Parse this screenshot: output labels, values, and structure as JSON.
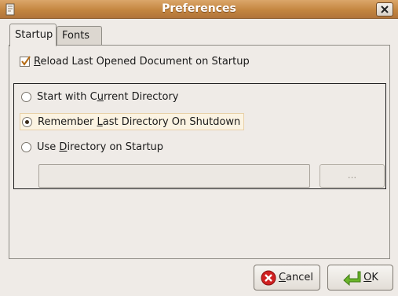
{
  "window": {
    "title": "Preferences"
  },
  "tabs": [
    {
      "label": "Startup",
      "active": true
    },
    {
      "label": "Fonts",
      "active": false
    }
  ],
  "startup": {
    "reload_checkbox": {
      "label_pre": "",
      "label_mnemonic": "R",
      "label_post": "eload Last Opened Document on Startup",
      "checked": true
    },
    "radios": [
      {
        "label_pre": "Start with C",
        "label_mnemonic": "u",
        "label_post": "rrent Directory",
        "selected": false
      },
      {
        "label_pre": "Remember ",
        "label_mnemonic": "L",
        "label_post": "ast Directory On Shutdown",
        "selected": true
      },
      {
        "label_pre": "Use ",
        "label_mnemonic": "D",
        "label_post": "irectory on Startup",
        "selected": false
      }
    ],
    "directory_value": "",
    "browse_label": "..."
  },
  "buttons": {
    "cancel": {
      "label_mnemonic": "C",
      "label_post": "ancel",
      "icon": "cancel-icon"
    },
    "ok": {
      "label_mnemonic": "O",
      "label_post": "K",
      "icon": "return-arrow-icon"
    }
  },
  "colors": {
    "titlebar": "#c48640",
    "window_bg": "#efebe7"
  }
}
